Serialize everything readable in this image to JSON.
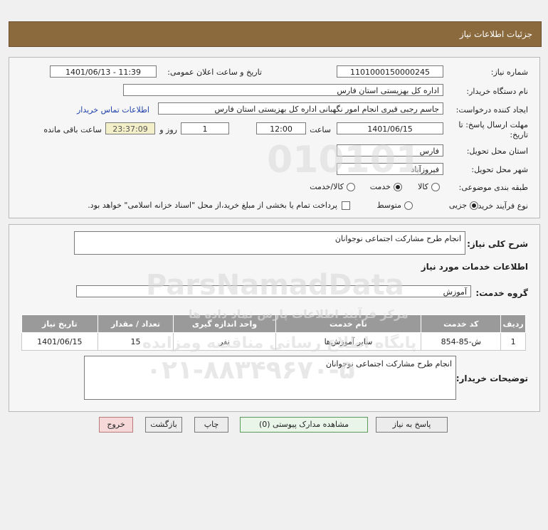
{
  "header": {
    "title": "جزئیات اطلاعات نیاز"
  },
  "form": {
    "need_number_label": "شماره نیاز:",
    "need_number": "1101000150000245",
    "announce_label": "تاریخ و ساعت اعلان عمومی:",
    "announce_value": "1401/06/13 - 11:39",
    "buyer_org_label": "نام دستگاه خریدار:",
    "buyer_org": "اداره کل بهزیستی استان فارس",
    "creator_label": "ایجاد کننده درخواست:",
    "creator": "جاسم رجبی قیری انجام امور نگهبانی اداره کل بهزیستی استان فارس",
    "contact_link": "اطلاعات تماس خریدار",
    "deadline_label_1": "مهلت ارسال پاسخ: تا",
    "deadline_label_2": "تاریخ:",
    "deadline_date": "1401/06/15",
    "time_label": "ساعت",
    "deadline_time": "12:00",
    "days_value": "1",
    "days_label": "روز و",
    "remaining_time": "23:37:09",
    "remaining_label": "ساعت باقی مانده",
    "province_label": "استان محل تحویل:",
    "province": "فارس",
    "city_label": "شهر محل تحویل:",
    "city": "فیروزآباد",
    "category_label": "طبقه بندی موضوعی:",
    "category_options": [
      "کالا",
      "خدمت",
      "کالا/خدمت"
    ],
    "category_selected": "خدمت",
    "process_label": "نوع فرآیند خرید :",
    "process_options": [
      "جزیی",
      "متوسط"
    ],
    "process_selected": "جزیی",
    "payment_note": "پرداخت تمام یا بخشی از مبلغ خرید،از محل \"اسناد خزانه اسلامی\" خواهد بود."
  },
  "summary": {
    "label": "شرح کلی نیاز:",
    "value": "انجام طرح مشارکت اجتماعی نوجوانان",
    "services_title": "اطلاعات خدمات مورد نیاز",
    "group_label": "گروه خدمت:",
    "group_value": "آموزش",
    "table": {
      "headers": [
        "ردیف",
        "کد خدمت",
        "نام خدمت",
        "واحد اندازه گیری",
        "تعداد / مقدار",
        "تاریخ نیاز"
      ],
      "rows": [
        [
          "1",
          "ش-85-854",
          "سایر آموزش‌ها",
          "نفر",
          "15",
          "1401/06/15"
        ]
      ]
    },
    "buyer_notes_label": "توضیحات خریدار:",
    "buyer_notes": "انجام طرح مشارکت اجتماعی نوجوانان"
  },
  "buttons": {
    "reply": "پاسخ به نیاز",
    "view_docs": "مشاهده مدارک پیوستی (0)",
    "print": "چاپ",
    "back": "بازگشت",
    "exit": "خروج"
  },
  "watermark": {
    "brand": "ParsNamadData",
    "phone": "۰۲۱-۸۸۳۴۹۶۷۰-۵",
    "line1": "مرکز فرآیند اطلاعات پارس نماد داده ها",
    "line2": "پایگاه اطلاع رسانی مناقصه ومزایده",
    "digits": "010101"
  }
}
